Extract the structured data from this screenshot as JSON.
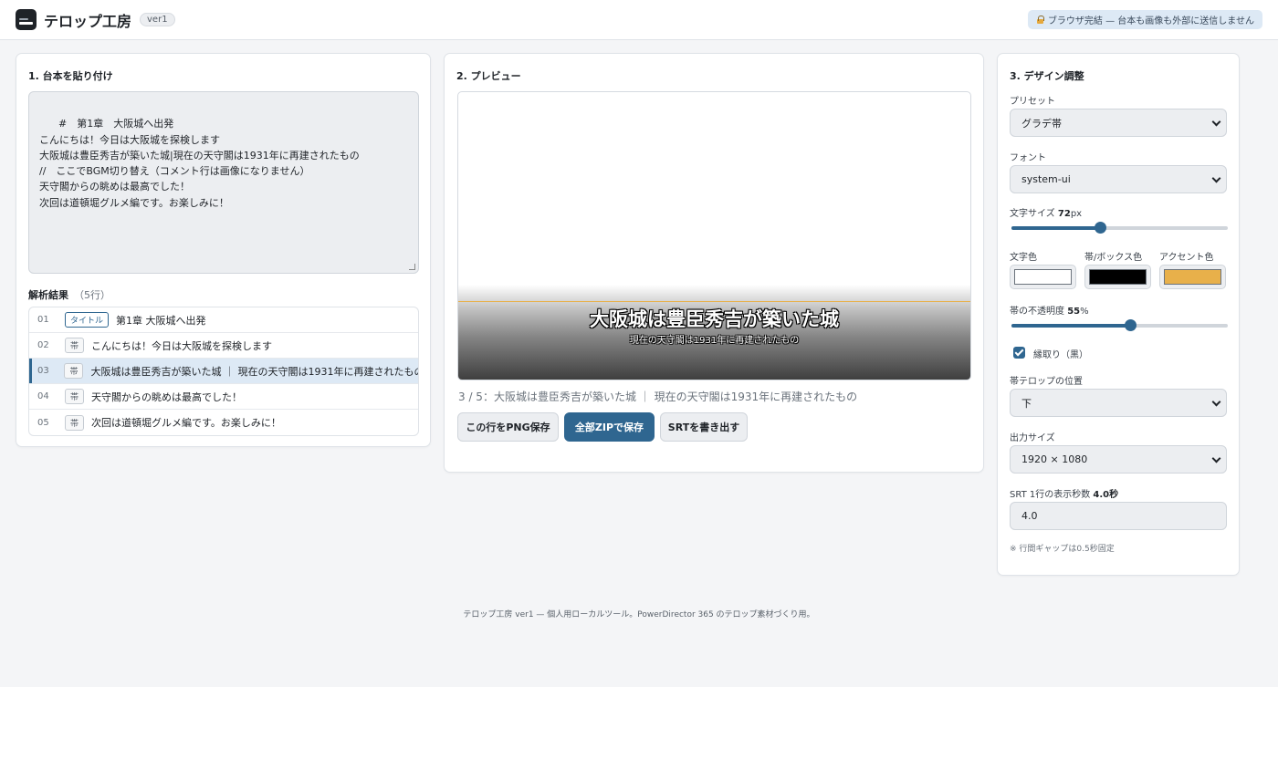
{
  "header": {
    "title": "テロップ工房",
    "version": "ver1",
    "privacy_note": "ブラウザ完結 — 台本も画像も外部に送信しません"
  },
  "script_panel": {
    "title": "1. 台本を貼り付け",
    "script_text": "#　第1章　大阪城へ出発\nこんにちは！今日は大阪城を探検します\n大阪城は豊臣秀吉が築いた城|現在の天守閣は1931年に再建されたもの\n//　ここでBGM切り替え（コメント行は画像になりません）\n天守閣からの眺めは最高でした！\n次回は道頓堀グルメ編です。お楽しみに！",
    "parse_label": "解析結果",
    "parse_count": "（5行）",
    "rows": [
      {
        "num": "01",
        "tag": "タイトル",
        "text": "第1章 大阪城へ出発"
      },
      {
        "num": "02",
        "tag": "帯",
        "text": "こんにちは！今日は大阪城を探検します"
      },
      {
        "num": "03",
        "tag": "帯",
        "text": "大阪城は豊臣秀吉が築いた城 ｜ 現在の天守閣は1931年に再建されたもの"
      },
      {
        "num": "04",
        "tag": "帯",
        "text": "天守閣からの眺めは最高でした！"
      },
      {
        "num": "05",
        "tag": "帯",
        "text": "次回は道頓堀グルメ編です。お楽しみに！"
      }
    ]
  },
  "preview_panel": {
    "title": "2. プレビュー",
    "caption_main": "大阪城は豊臣秀吉が築いた城",
    "caption_sub": "現在の天守閣は1931年に再建されたもの",
    "status": "3 / 5：大阪城は豊臣秀吉が築いた城 ｜ 現在の天守閣は1931年に再建されたもの",
    "btn_png": "この行をPNG保存",
    "btn_zip": "全部ZIPで保存",
    "btn_srt": "SRTを書き出す"
  },
  "design_panel": {
    "title": "3. デザイン調整",
    "preset_label": "プリセット",
    "preset_value": "グラデ帯",
    "font_label": "フォント",
    "font_value": "system-ui",
    "size_label": "文字サイズ",
    "size_value": "72",
    "size_unit": "px",
    "size_fraction": 0.41,
    "text_color_label": "文字色",
    "band_color_label": "帯/ボックス色",
    "accent_color_label": "アクセント色",
    "text_color": "#ffffff",
    "band_color": "#000000",
    "accent_color": "#e8b04a",
    "opacity_label": "帯の不透明度",
    "opacity_value": "55",
    "opacity_unit": "%",
    "opacity_fraction": 0.55,
    "outline_label": "縁取り（黒）",
    "position_label": "帯テロップの位置",
    "position_value": "下",
    "output_label": "出力サイズ",
    "output_value": "1920 × 1080",
    "srt_label": "SRT 1行の表示秒数",
    "srt_seconds": "4.0秒",
    "srt_input_value": "4.0",
    "gap_note": "※ 行間ギャップは0.5秒固定"
  },
  "footer": {
    "text": "テロップ工房 ver1 — 個人用ローカルツール。PowerDirector 365 のテロップ素材づくり用。"
  },
  "colors": {
    "accent": "#2f6690",
    "selected_row": "#dde9f5"
  }
}
